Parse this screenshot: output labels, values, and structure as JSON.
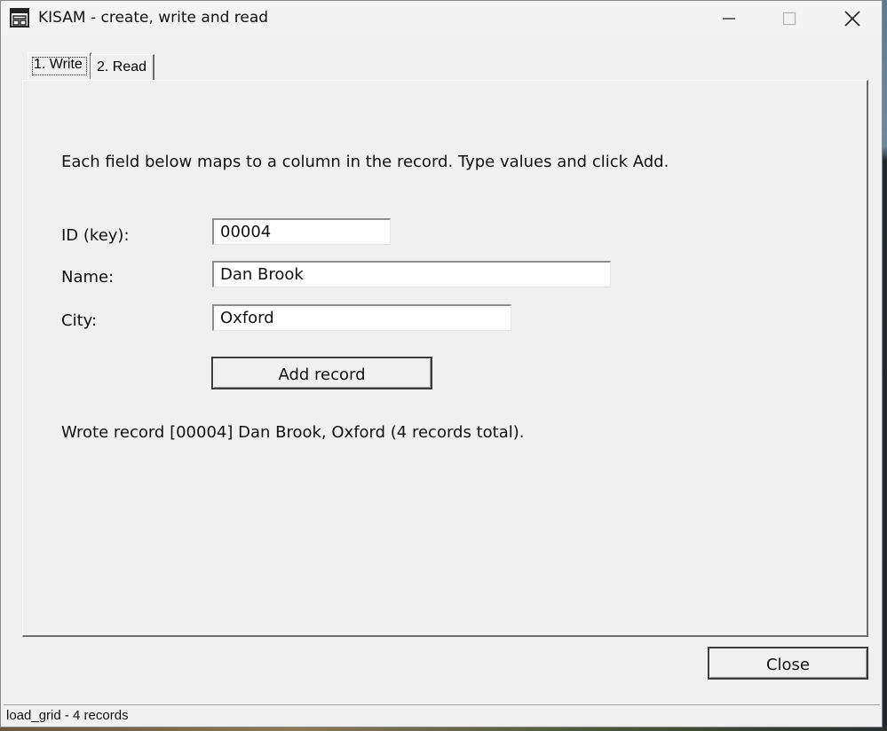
{
  "window": {
    "title": "KISAM - create, write and read",
    "icon": "form-window-icon"
  },
  "tabs": [
    {
      "label": "1. Write",
      "active": true
    },
    {
      "label": "2. Read",
      "active": false
    }
  ],
  "write_tab": {
    "instructions": "Each field below maps to a column in the record. Type values and click Add.",
    "fields": {
      "id": {
        "label": "ID (key):",
        "value": "00004"
      },
      "name": {
        "label": "Name:",
        "value": "Dan Brook"
      },
      "city": {
        "label": "City:",
        "value": "Oxford"
      }
    },
    "add_button": "Add record",
    "status_message": "Wrote record [00004] Dan Brook, Oxford  (4 records total)."
  },
  "close_button": "Close",
  "statusbar": "load_grid - 4 records"
}
